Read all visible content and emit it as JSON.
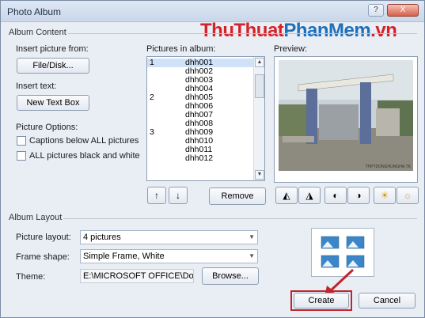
{
  "window": {
    "title": "Photo Album",
    "help_label": "?",
    "close_label": "X"
  },
  "watermark": {
    "part1": "ThuThuat",
    "part2": "PhanMem",
    "part3": ".vn"
  },
  "album_content": {
    "group_label": "Album Content",
    "insert_picture_label": "Insert picture from:",
    "file_disk_button": "File/Disk...",
    "insert_text_label": "Insert text:",
    "new_text_box_button": "New Text Box",
    "picture_options_label": "Picture Options:",
    "captions_option": "Captions below ALL pictures",
    "black_white_option": "ALL pictures black and white",
    "pictures_in_album_label": "Pictures in album:",
    "pictures": [
      {
        "num": "1",
        "name": "dhh001",
        "selected": true
      },
      {
        "num": "",
        "name": "dhh002",
        "selected": false
      },
      {
        "num": "",
        "name": "dhh003",
        "selected": false
      },
      {
        "num": "",
        "name": "dhh004",
        "selected": false
      },
      {
        "num": "2",
        "name": "dhh005",
        "selected": false
      },
      {
        "num": "",
        "name": "dhh006",
        "selected": false
      },
      {
        "num": "",
        "name": "dhh007",
        "selected": false
      },
      {
        "num": "",
        "name": "dhh008",
        "selected": false
      },
      {
        "num": "3",
        "name": "dhh009",
        "selected": false
      },
      {
        "num": "",
        "name": "dhh010",
        "selected": false
      },
      {
        "num": "",
        "name": "dhh011",
        "selected": false
      },
      {
        "num": "",
        "name": "dhh012",
        "selected": false
      }
    ],
    "move_up_label": "↑",
    "move_down_label": "↓",
    "remove_button": "Remove",
    "preview_label": "Preview:",
    "preview_caption": "THPTDONGHUNGHA.TK"
  },
  "album_layout": {
    "group_label": "Album Layout",
    "picture_layout_label": "Picture layout:",
    "picture_layout_value": "4 pictures",
    "frame_shape_label": "Frame shape:",
    "frame_shape_value": "Simple Frame, White",
    "theme_label": "Theme:",
    "theme_value": "E:\\MICROSOFT OFFICE\\Docu",
    "browse_button": "Browse..."
  },
  "footer": {
    "create_button": "Create",
    "cancel_button": "Cancel"
  },
  "colors": {
    "highlight_box": "#c0262c",
    "arrow": "#c0262c",
    "selection": "#cfe2f7"
  }
}
